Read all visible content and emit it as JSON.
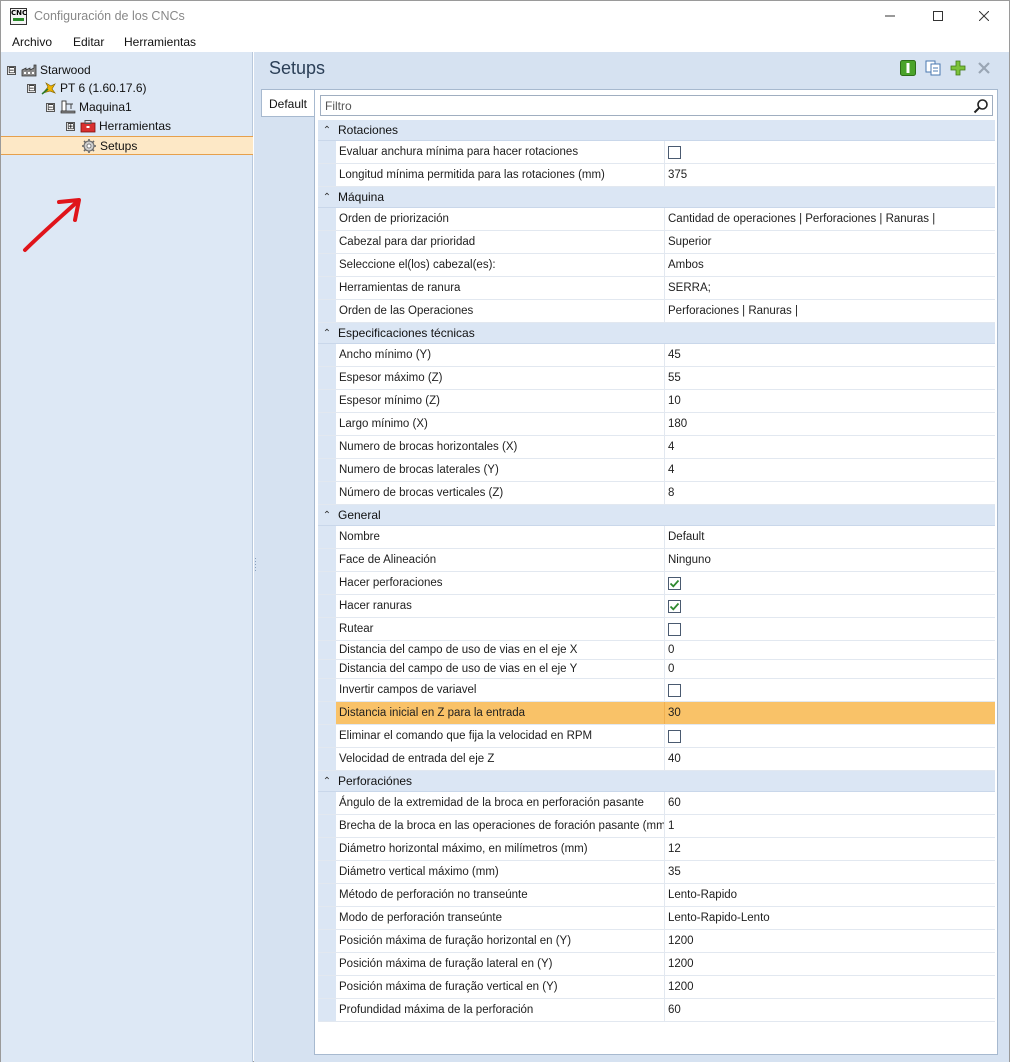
{
  "window": {
    "title": "Configuración de los CNCs",
    "app_icon_text": "CNC",
    "controls": {
      "minimize": "—",
      "maximize": "☐",
      "close": "✕"
    }
  },
  "menu": [
    "Archivo",
    "Editar",
    "Herramientas"
  ],
  "tree": {
    "root": {
      "label": "Starwood",
      "icon": "factory-icon",
      "toggle": "⊟"
    },
    "machine_group": {
      "label": "PT 6 (1.60.17.6)",
      "icon": "star-tool-icon",
      "toggle": "⊟"
    },
    "machine": {
      "label": "Maquina1",
      "icon": "machine-icon",
      "toggle": "⊟"
    },
    "tools": {
      "label": "Herramientas",
      "icon": "toolbox-icon",
      "toggle": "⊞"
    },
    "setups": {
      "label": "Setups",
      "icon": "gear-icon",
      "selected": true
    }
  },
  "annotation": {
    "icon": "red-arrow-icon",
    "color": "#e0141a"
  },
  "main": {
    "title": "Setups",
    "toolbar": [
      "info-icon",
      "copy-icon",
      "add-icon",
      "delete-icon"
    ],
    "tab": "Default",
    "filter_placeholder": "Filtro",
    "colors": {
      "highlight": "#f9c268",
      "category_bg": "#dbe6f4",
      "pane_bg": "#d6e2f1"
    }
  },
  "categories": [
    {
      "label": "Rotaciones",
      "rows": [
        {
          "name": "Evaluar anchura mínima para hacer rotaciones",
          "type": "checkbox",
          "checked": false
        },
        {
          "name": "Longitud mínima permitida para las rotaciones (mm)",
          "value": "375"
        }
      ]
    },
    {
      "label": "Máquina",
      "rows": [
        {
          "name": "Orden de priorización",
          "value": "Cantidad de operaciones | Perforaciones | Ranuras |"
        },
        {
          "name": "Cabezal para dar prioridad",
          "value": "Superior"
        },
        {
          "name": "Seleccione el(los) cabezal(es):",
          "value": "Ambos"
        },
        {
          "name": "Herramientas de ranura",
          "value": "SERRA;"
        },
        {
          "name": "Orden de las Operaciones",
          "value": "Perforaciones | Ranuras |"
        }
      ]
    },
    {
      "label": "Especificaciones técnicas",
      "rows": [
        {
          "name": "Ancho mínimo (Y)",
          "value": "45"
        },
        {
          "name": "Espesor máximo (Z)",
          "value": "55"
        },
        {
          "name": "Espesor mínimo (Z)",
          "value": "10"
        },
        {
          "name": "Largo mínimo (X)",
          "value": "180"
        },
        {
          "name": "Numero de brocas horizontales (X)",
          "value": "4"
        },
        {
          "name": "Numero de brocas laterales (Y)",
          "value": "4"
        },
        {
          "name": "Número de brocas verticales (Z)",
          "value": "8"
        }
      ]
    },
    {
      "label": "General",
      "rows": [
        {
          "name": "Nombre",
          "value": "Default"
        },
        {
          "name": "Face de Alineación",
          "value": "Ninguno"
        },
        {
          "name": "Hacer perforaciones",
          "type": "checkbox",
          "checked": true
        },
        {
          "name": "Hacer ranuras",
          "type": "checkbox",
          "checked": true
        },
        {
          "name": "Rutear",
          "type": "checkbox",
          "checked": false
        },
        {
          "name": "Distancia del campo de uso de vias en el eje X",
          "value": "0",
          "short": true
        },
        {
          "name": "Distancia del campo de uso de vias en el eje Y",
          "value": "0",
          "short": true
        },
        {
          "name": "Invertir campos de variavel",
          "type": "checkbox",
          "checked": false
        },
        {
          "name": "Distancia inicial en Z para la entrada",
          "value": "30",
          "highlighted": true
        },
        {
          "name": "Eliminar el comando que fija la velocidad en RPM",
          "type": "checkbox",
          "checked": false
        },
        {
          "name": "Velocidad de entrada del eje Z",
          "value": "40"
        }
      ]
    },
    {
      "label": "Perforaciónes",
      "rows": [
        {
          "name": "Ángulo de la extremidad de la broca en perforación pasante",
          "value": "60"
        },
        {
          "name": "Brecha de la broca en las operaciones de foración pasante (mm)",
          "value": "1"
        },
        {
          "name": "Diámetro horizontal máximo, en milímetros (mm)",
          "value": "12"
        },
        {
          "name": "Diámetro vertical máximo (mm)",
          "value": "35"
        },
        {
          "name": "Método de perforación no transeúnte",
          "value": "Lento-Rapido"
        },
        {
          "name": "Modo de perforación transeúnte",
          "value": "Lento-Rapido-Lento"
        },
        {
          "name": "Posición máxima de furação horizontal en (Y)",
          "value": "1200"
        },
        {
          "name": "Posición máxima de furação lateral en (Y)",
          "value": "1200"
        },
        {
          "name": "Posición máxima de furação vertical en (Y)",
          "value": "1200"
        },
        {
          "name": "Profundidad máxima de la perforación",
          "value": "60"
        }
      ]
    }
  ]
}
